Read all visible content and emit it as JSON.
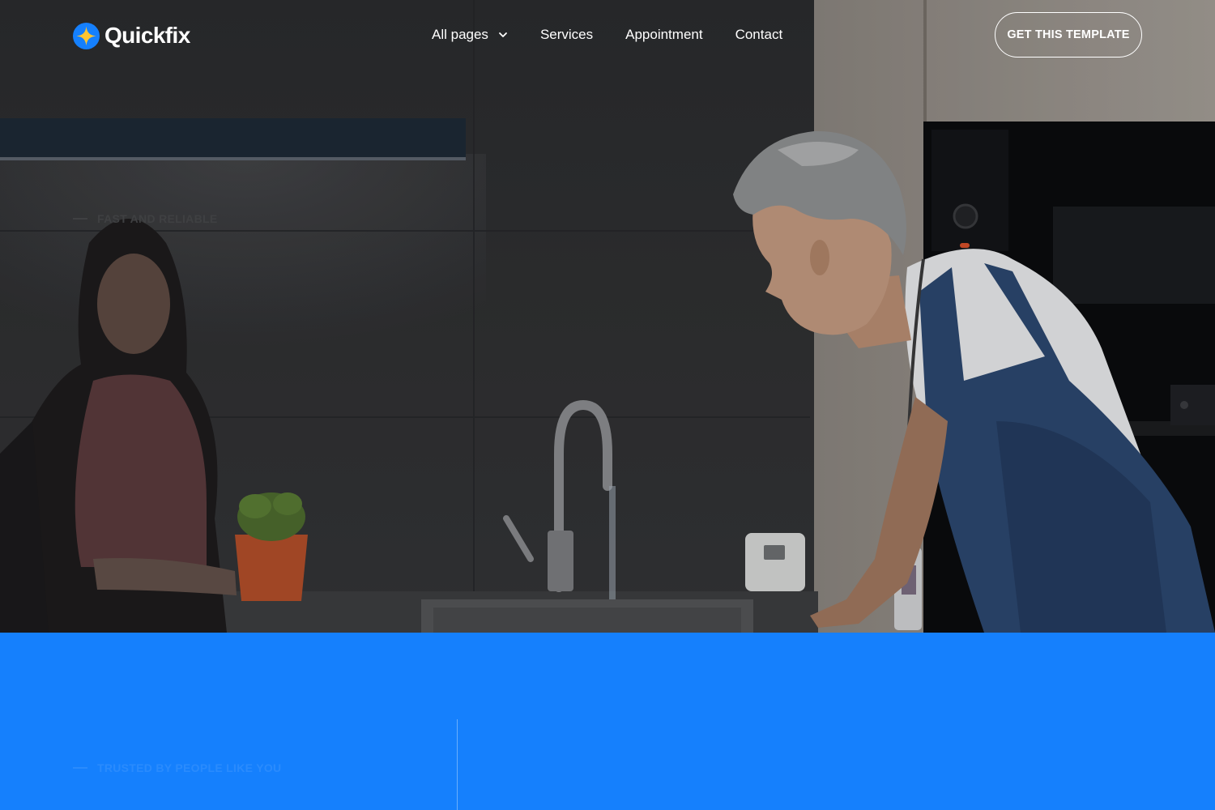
{
  "brand": {
    "name": "Quickfix",
    "icon": "sparkle-logo-icon",
    "accent": "#1580FD",
    "star_color": "#FFC531"
  },
  "nav": {
    "items": [
      {
        "label": "All pages",
        "icon": "chevron-down-icon"
      },
      {
        "label": "Services"
      },
      {
        "label": "Appointment"
      },
      {
        "label": "Contact"
      }
    ],
    "cta_label": "GET THIS TEMPLATE"
  },
  "hero": {
    "eyebrow": "FAST AND RELIABLE"
  },
  "trust_section": {
    "eyebrow": "TRUSTED BY PEOPLE LIKE YOU",
    "background": "#1580FD"
  }
}
